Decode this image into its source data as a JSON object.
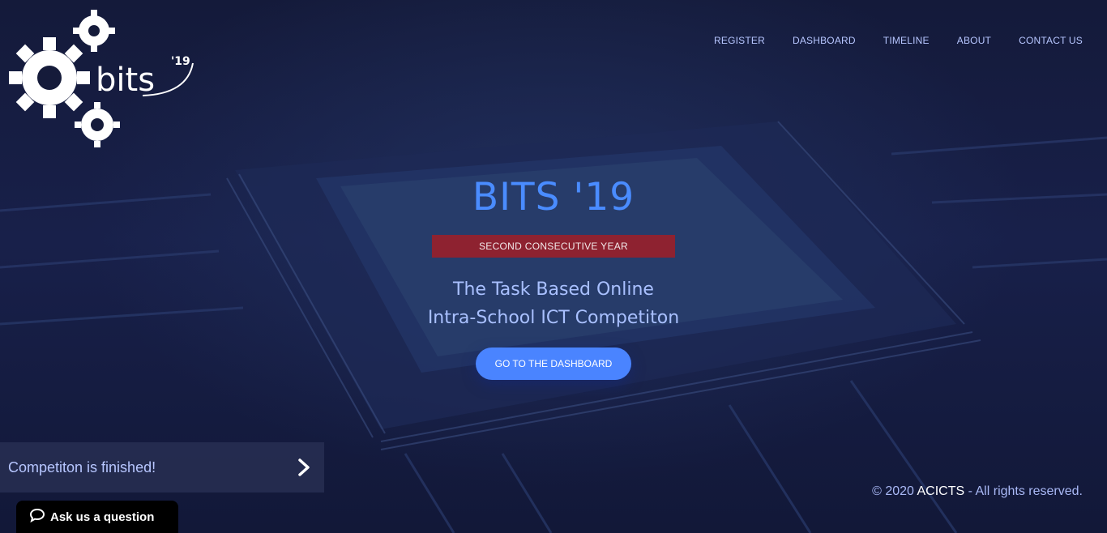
{
  "nav": {
    "items": [
      {
        "label": "REGISTER"
      },
      {
        "label": "DASHBOARD"
      },
      {
        "label": "TIMELINE"
      },
      {
        "label": "ABOUT"
      },
      {
        "label": "CONTACT US"
      }
    ]
  },
  "logo": {
    "text": "bits",
    "year": "'19"
  },
  "hero": {
    "title": "BITS '19",
    "ribbon": "SECOND CONSECUTIVE YEAR",
    "tagline_line1": "The Task Based Online",
    "tagline_line2": "Intra-School ICT Competiton",
    "cta_label": "GO TO THE DASHBOARD"
  },
  "notice": {
    "message": "Competiton is finished!"
  },
  "footer": {
    "copyright": "© 2020 ",
    "brand": "ACICTS",
    "rights": " - All rights reserved."
  },
  "chat": {
    "label": "Ask us a question"
  },
  "colors": {
    "accent": "#4a84ff",
    "title": "#4a8cff",
    "ribbon": "#8e2230",
    "nav_text": "#b7c6ff",
    "background": "#141a3a"
  },
  "icons": {
    "notice_arrow": "chevron-right-icon",
    "chat": "speech-bubble-icon"
  }
}
